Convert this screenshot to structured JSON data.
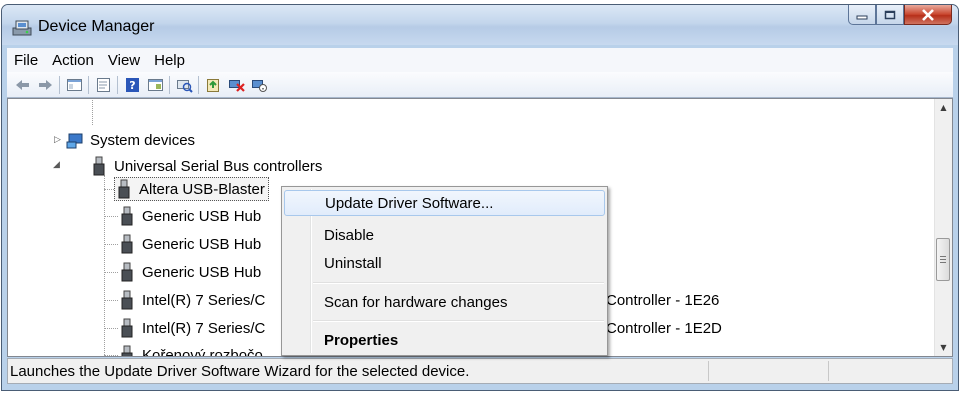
{
  "window": {
    "title": "Device Manager"
  },
  "menubar": {
    "items": [
      "File",
      "Action",
      "View",
      "Help"
    ]
  },
  "toolbar": {
    "icons": [
      "back-arrow-icon",
      "forward-arrow-icon",
      "show-hide-console-tree-icon",
      "properties-sheet-icon",
      "help-icon",
      "action-pane-icon",
      "scan-hardware-icon",
      "update-driver-icon",
      "uninstall-device-icon",
      "disable-device-icon"
    ]
  },
  "tree": {
    "system_devices": "System devices",
    "usb_controllers": "Universal Serial Bus controllers",
    "children": [
      "Altera USB-Blaster",
      "Generic USB Hub",
      "Generic USB Hub",
      "Generic USB Hub",
      "Intel(R) 7 Series/C",
      "Intel(R) 7 Series/C",
      "Kořenový rozbočo"
    ],
    "controller_suffix_1": "Controller - 1E26",
    "controller_suffix_2": "Controller - 1E2D"
  },
  "context_menu": {
    "items": [
      {
        "label": "Update Driver Software...",
        "highlighted": true
      },
      {
        "label": "Disable"
      },
      {
        "label": "Uninstall"
      },
      {
        "label": "Scan for hardware changes"
      },
      {
        "label": "Properties",
        "bold": true
      }
    ]
  },
  "statusbar": {
    "text": "Launches the Update Driver Software Wizard for the selected device."
  },
  "colors": {
    "titlebar": "#c3d6ec",
    "selection_border": "#a8c8ec",
    "close_button": "#c8452d"
  }
}
